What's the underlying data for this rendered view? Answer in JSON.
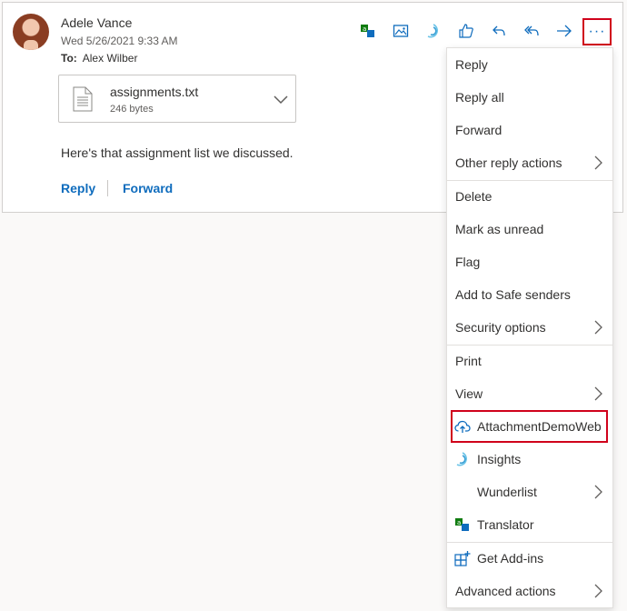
{
  "message": {
    "sender": "Adele Vance",
    "date": "Wed 5/26/2021 9:33 AM",
    "to_label": "To:",
    "to_name": "Alex Wilber",
    "body": "Here's that assignment list we discussed.",
    "attachment": {
      "name": "assignments.txt",
      "size": "246 bytes"
    },
    "quick_actions": {
      "reply": "Reply",
      "forward": "Forward"
    }
  },
  "toolbar": {
    "icons": [
      "translator-icon",
      "image-icon",
      "insights-icon",
      "like-icon",
      "reply-icon",
      "reply-all-icon",
      "forward-icon",
      "more-actions-icon"
    ],
    "more_label": "···"
  },
  "menu": {
    "items": [
      {
        "label": "Reply"
      },
      {
        "label": "Reply all"
      },
      {
        "label": "Forward"
      },
      {
        "label": "Other reply actions",
        "submenu": true
      },
      {
        "label": "Delete"
      },
      {
        "label": "Mark as unread"
      },
      {
        "label": "Flag"
      },
      {
        "label": "Add to Safe senders"
      },
      {
        "label": "Security options",
        "submenu": true
      },
      {
        "label": "Print"
      },
      {
        "label": "View",
        "submenu": true
      },
      {
        "label": "AttachmentDemoWeb",
        "icon": "cloud-upload-icon",
        "highlighted": true
      },
      {
        "label": "Insights",
        "icon": "insights-icon"
      },
      {
        "label": "Wunderlist",
        "submenu": true
      },
      {
        "label": "Translator",
        "icon": "translator-icon"
      },
      {
        "label": "Get Add-ins",
        "icon": "add-ins-icon"
      },
      {
        "label": "Advanced actions",
        "submenu": true
      }
    ]
  },
  "colors": {
    "accent": "#0f6cbd",
    "highlight_border": "#d0021b"
  }
}
